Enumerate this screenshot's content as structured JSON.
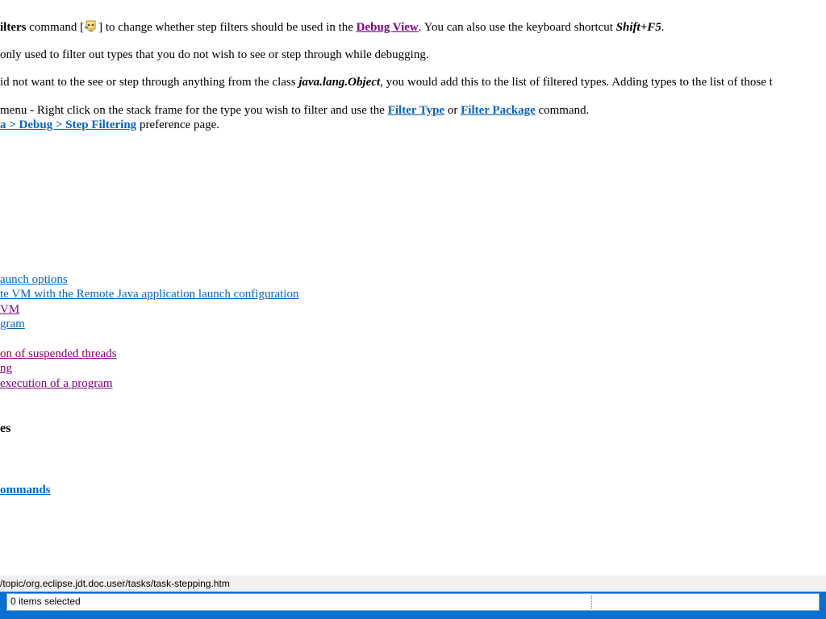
{
  "paragraphs": {
    "p1": {
      "bold_start": "ilters",
      "text1": " command [",
      "text2": "] to change whether step filters should be used in the ",
      "link": "Debug View",
      "text3": ". You can also use the keyboard shortcut ",
      "shortcut": "Shift+F5",
      "text4": "."
    },
    "p2": "only used to filter out types that you do not wish to see or step through while debugging.",
    "p3": {
      "text1": "id not want to the see or step through anything from the class ",
      "class_name": "java.lang.Object",
      "text2": ", you would add this to the list of filtered types. Adding types to the list of those t"
    },
    "p4": {
      "text1": " menu - Right click on the stack frame for the type you wish to filter and use the ",
      "link1": "Filter Type",
      "or": " or ",
      "link2": "Filter Package",
      "text2": " command."
    },
    "p5": {
      "link": "a > Debug > Step Filtering",
      "text": " preference page."
    }
  },
  "related_links": [
    "aunch options",
    "te VM with the Remote Java application launch configuration",
    " VM",
    "gram",
    "on of suspended threads",
    "ng",
    "execution of a program"
  ],
  "section_heading": "es",
  "reference_link": "ommands",
  "url_text": "/topic/org.eclipse.jdt.doc.user/tasks/task-stepping.htm",
  "status_text": "0 items selected",
  "colors": {
    "link": "#0563c1",
    "visited": "#800080",
    "status_blue": "#0a6fd1"
  },
  "icons": {
    "step_filter": "step-filter-icon"
  }
}
